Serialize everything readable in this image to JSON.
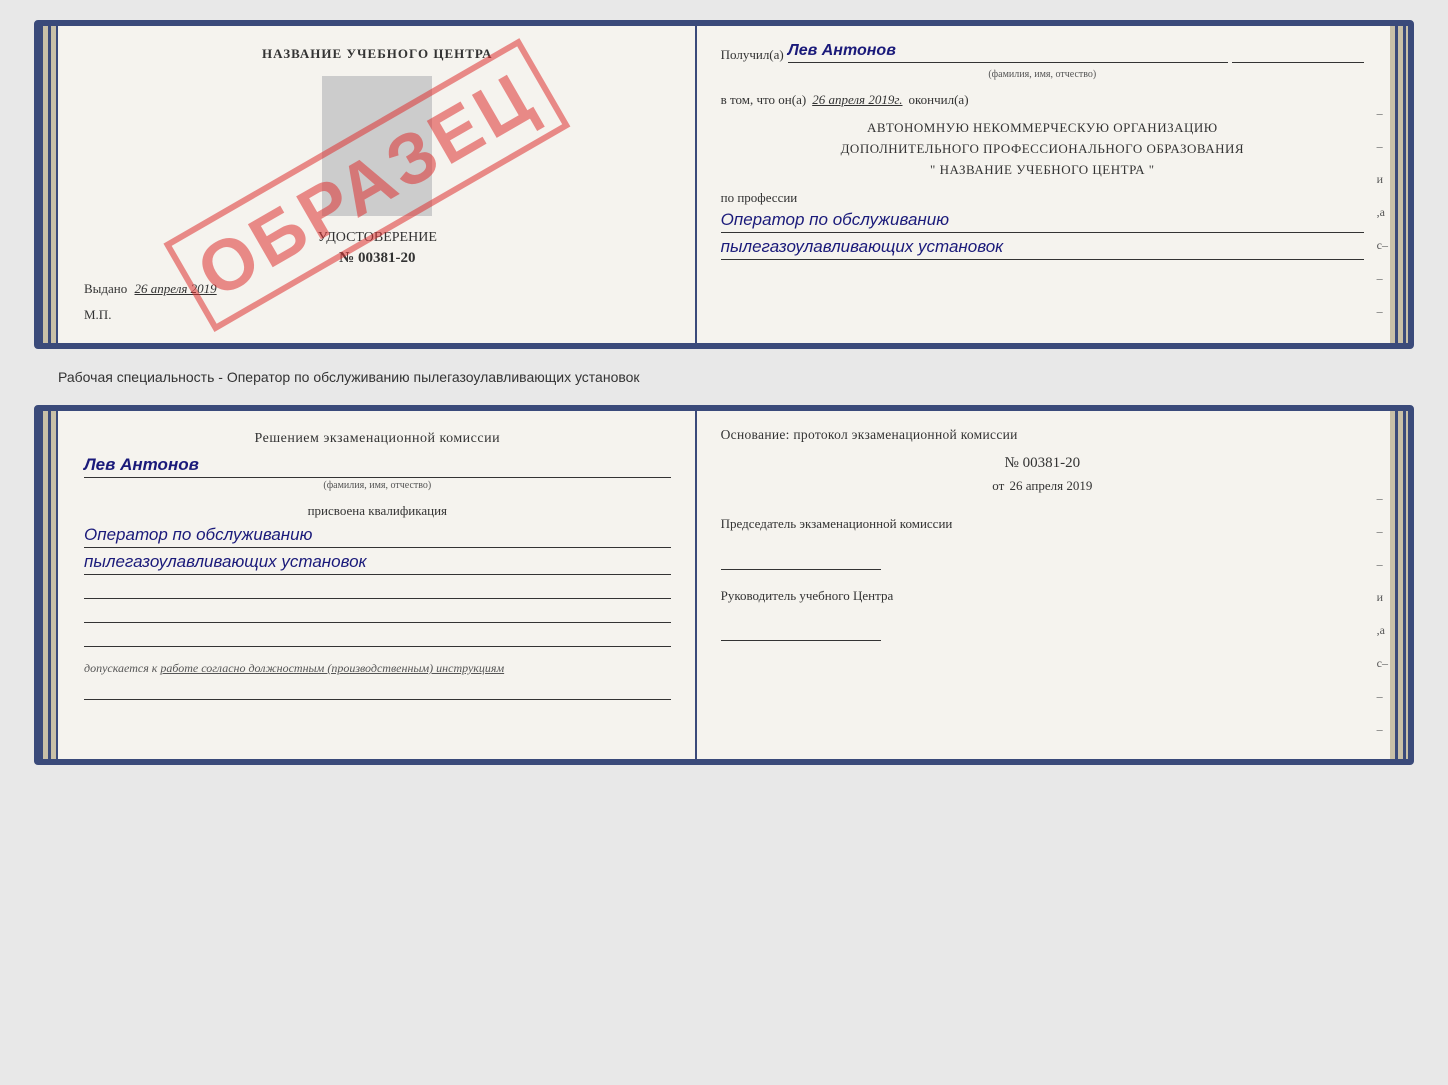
{
  "page": {
    "background": "#e8e8e8"
  },
  "card1": {
    "left": {
      "title": "НАЗВАНИЕ УЧЕБНОГО ЦЕНТРА",
      "cert_type": "УДОСТОВЕРЕНИЕ",
      "cert_number": "№ 00381-20",
      "issued_label": "Выдано",
      "issued_date": "26 апреля 2019",
      "mp_label": "М.П.",
      "stamp_text": "ОБРАЗЕЦ"
    },
    "right": {
      "received_label": "Получил(а)",
      "received_name": "Лев Антонов",
      "fio_sub": "(фамилия, имя, отчество)",
      "in_that_prefix": "в том, что он(а)",
      "in_that_date": "26 апреля 2019г.",
      "finished_label": "окончил(а)",
      "org_line1": "АВТОНОМНУЮ НЕКОММЕРЧЕСКУЮ ОРГАНИЗАЦИЮ",
      "org_line2": "ДОПОЛНИТЕЛЬНОГО ПРОФЕССИОНАЛЬНОГО ОБРАЗОВАНИЯ",
      "org_line3": "\"   НАЗВАНИЕ УЧЕБНОГО ЦЕНТРА   \"",
      "profession_label": "по профессии",
      "profession_line1": "Оператор по обслуживанию",
      "profession_line2": "пылегазоулавливающих установок"
    }
  },
  "middle_label": "Рабочая специальность - Оператор по обслуживанию пылегазоулавливающих установок",
  "card2": {
    "left": {
      "commission_prefix": "Решением экзаменационной комиссии",
      "person_name": "Лев Антонов",
      "fio_sub": "(фамилия, имя, отчество)",
      "assigned_label": "присвоена квалификация",
      "qual_line1": "Оператор по обслуживанию",
      "qual_line2": "пылегазоулавливающих установок",
      "blank_lines": 3,
      "allowed_prefix": "допускается к",
      "allowed_text": "работе согласно должностным (производственным) инструкциям"
    },
    "right": {
      "basis_label": "Основание: протокол экзаменационной комиссии",
      "protocol_number": "№  00381-20",
      "protocol_date_prefix": "от",
      "protocol_date": "26 апреля 2019",
      "chairman_label": "Председатель экзаменационной комиссии",
      "head_label": "Руководитель учебного Центра"
    }
  }
}
